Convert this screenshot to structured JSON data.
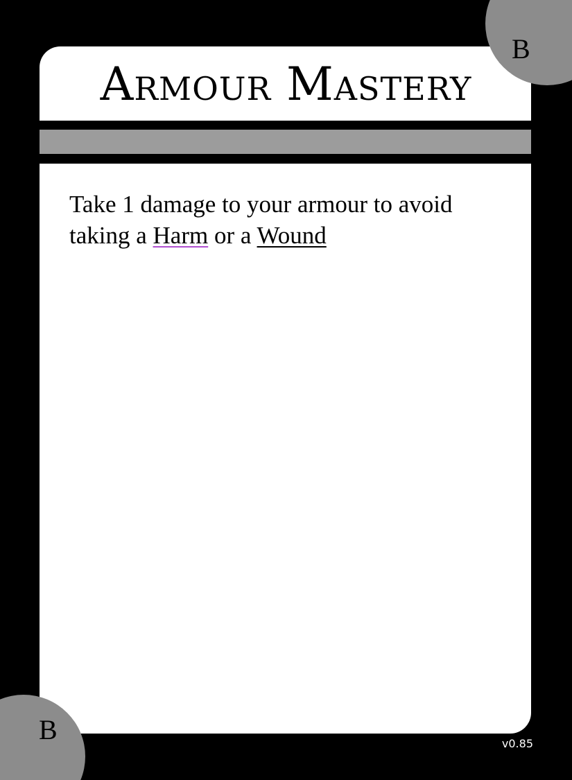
{
  "card": {
    "title": "Armour Mastery",
    "rank_top": "B",
    "rank_bottom": "B",
    "version": "v0.85",
    "body": {
      "text_before": "Take 1 damage to your armour to avoid taking a ",
      "keyword_harm": "Harm",
      "text_middle": " or a ",
      "keyword_wound": "Wound"
    },
    "colors": {
      "background": "#000000",
      "panel": "#ffffff",
      "bar": "#9c9c9c",
      "badge": "#8c8c8c",
      "harm_underline": "#b04fd0"
    }
  }
}
